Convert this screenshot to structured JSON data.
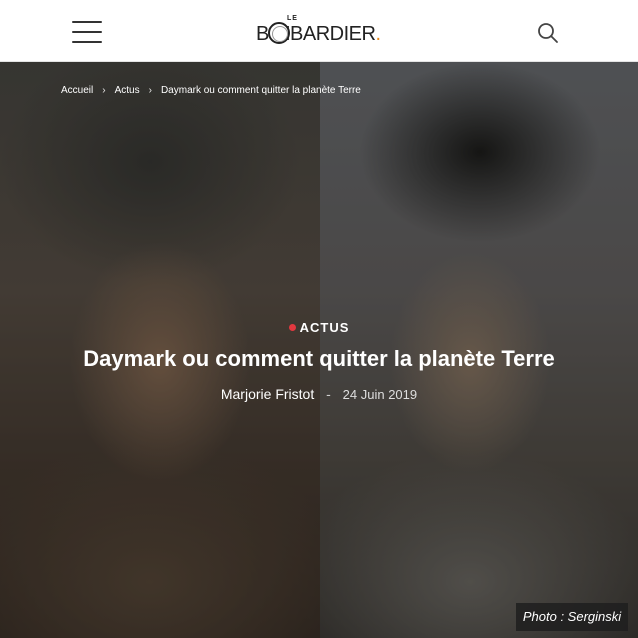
{
  "header": {
    "logo": {
      "small_text": "LE",
      "main_text": "B MBARDIER",
      "dot": "."
    },
    "menu_icon": "hamburger-menu-icon",
    "search_icon": "search-icon"
  },
  "breadcrumb": {
    "items": [
      "Accueil",
      "Actus",
      "Daymark ou comment quitter la planète Terre"
    ],
    "separator": "›"
  },
  "article": {
    "category": "ACTUS",
    "title": "Daymark ou comment quitter la planète Terre",
    "author": "Marjorie Fristot",
    "separator": "-",
    "date": "24 Juin 2019",
    "photo_credit": "Photo : Serginski"
  },
  "colors": {
    "category_dot": "#e2383f",
    "logo_dot": "#e98a1a",
    "header_bg": "#ffffff"
  }
}
